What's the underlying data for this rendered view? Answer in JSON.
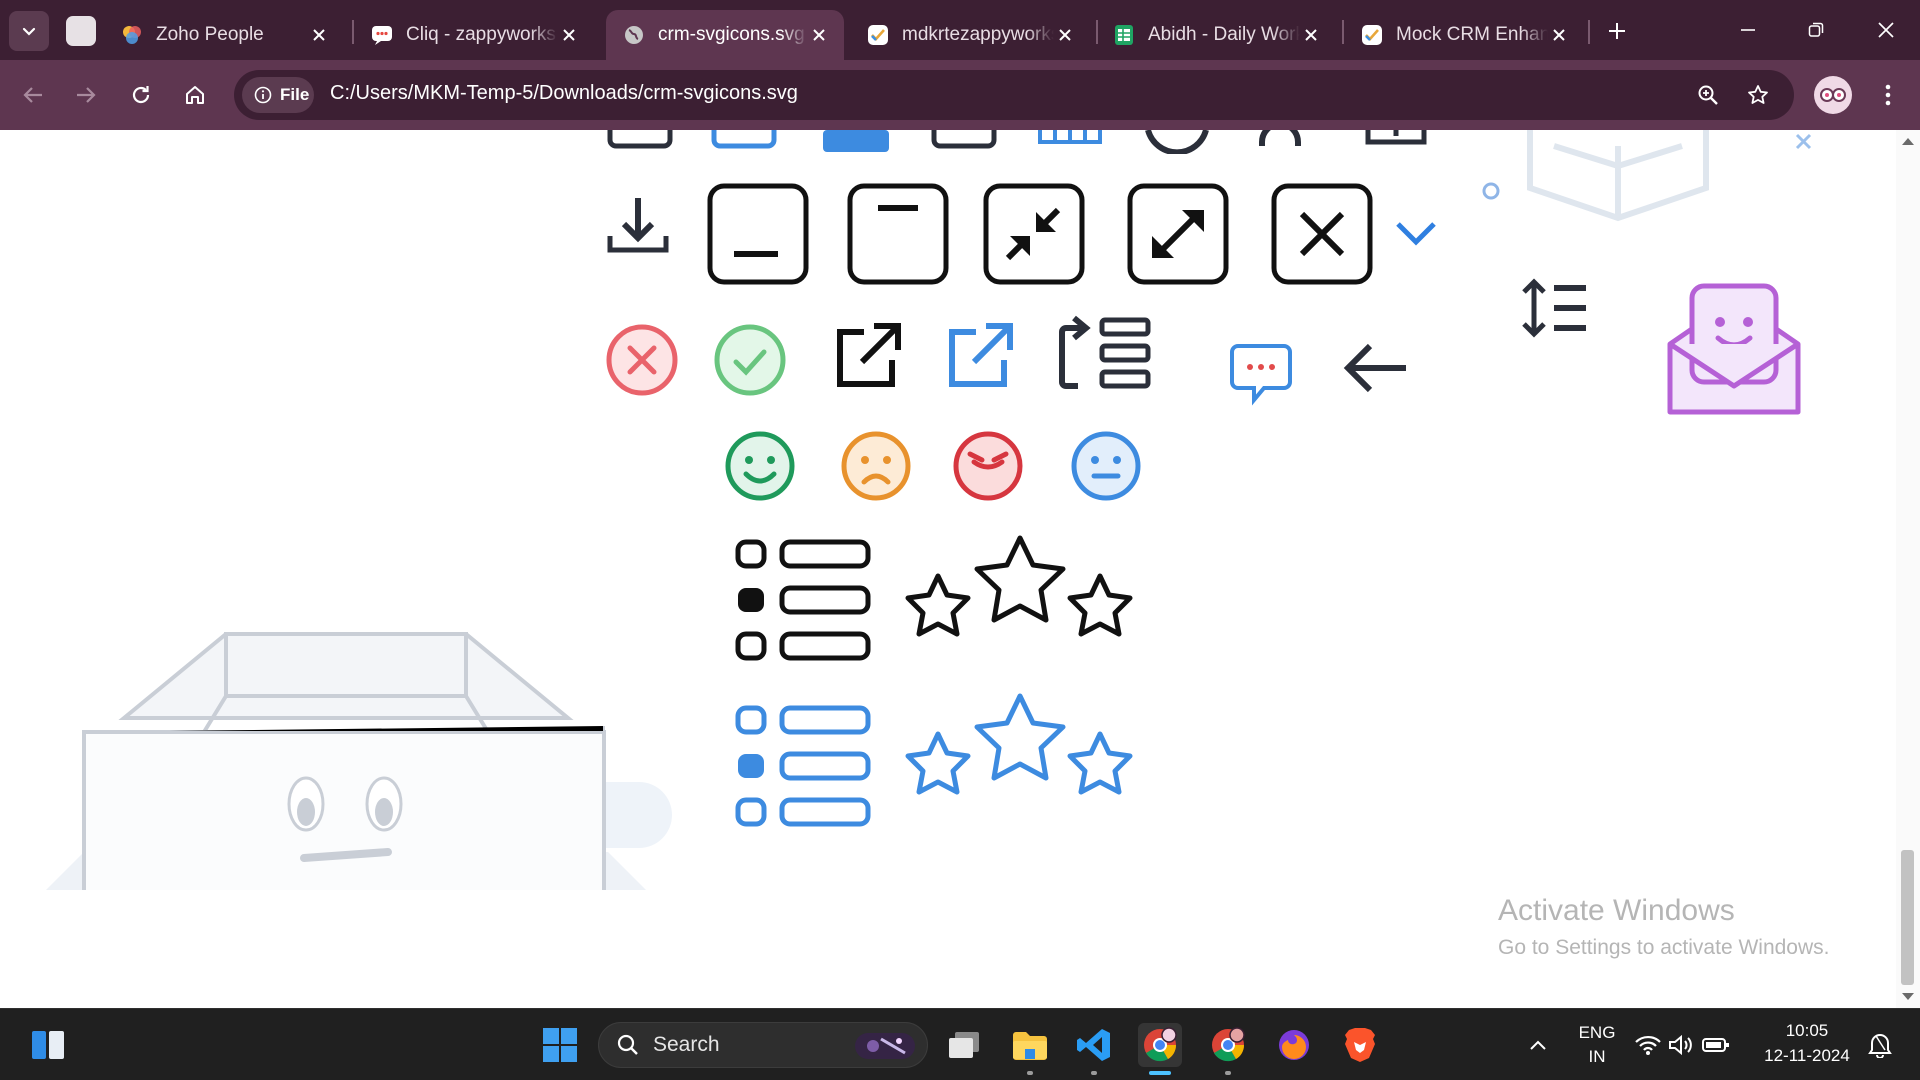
{
  "browser": {
    "tabs": [
      {
        "title": "Zoho People",
        "favicon": "zoho-people-icon",
        "active": false
      },
      {
        "title": "Cliq - zappyworks",
        "favicon": "cliq-icon",
        "active": false
      },
      {
        "title": "crm-svgicons.svg",
        "favicon": "globe-icon",
        "active": true
      },
      {
        "title": "mdkrtezappyworks",
        "favicon": "task-check-icon",
        "active": false
      },
      {
        "title": "Abidh - Daily Work",
        "favicon": "sheet-icon",
        "active": false
      },
      {
        "title": "Mock CRM Enhancements",
        "favicon": "task-check-icon",
        "active": false
      }
    ],
    "site_chip_label": "File",
    "url": "C:/Users/MKM-Temp-5/Downloads/crm-svgicons.svg"
  },
  "watermark": {
    "title": "Activate Windows",
    "subtitle": "Go to Settings to activate Windows."
  },
  "taskbar": {
    "search_label": "Search",
    "language_line1": "ENG",
    "language_line2": "IN",
    "time": "10:05",
    "date": "12-11-2024"
  },
  "colors": {
    "tab_strip": "#3c1f33",
    "toolbar": "#5e3650",
    "icon_dark": "#2b2f3a",
    "icon_blue": "#3d8be0",
    "error_red": "#e9636b",
    "success_green": "#69c57f",
    "purple": "#b561d6"
  }
}
